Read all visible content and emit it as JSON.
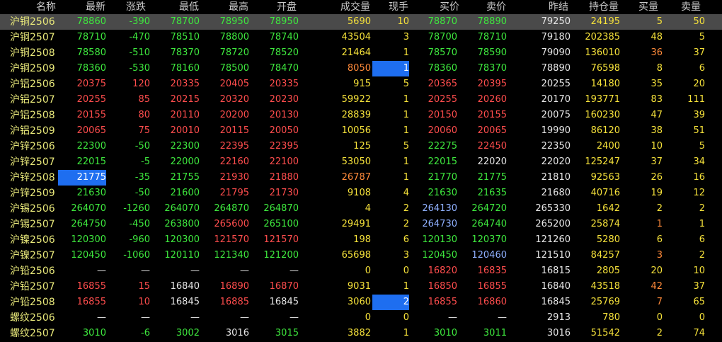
{
  "colors": {
    "up": "#ff4d4d",
    "down": "#3ee83e",
    "flat": "#e6e6e6",
    "yellow": "#f5e13a",
    "orange": "#ff8a3a",
    "blue": "#8fb0ff",
    "highlight": "#1e6ef0"
  },
  "headers": {
    "name": "名称",
    "last": "最新",
    "chg": "涨跌",
    "low": "最低",
    "high": "最高",
    "open": "开盘",
    "vol": "成交量",
    "cur": "现手",
    "bid": "买价",
    "ask": "卖价",
    "pre": "昨结",
    "oi": "持仓量",
    "bq": "买量",
    "aq": "卖量"
  },
  "rows": [
    {
      "name": "沪铜2506",
      "last": "78860",
      "chg": "-390",
      "low": "78700",
      "high": "78950",
      "open": "78950",
      "vol": "5690",
      "cur": "10",
      "bid": "78870",
      "ask": "78890",
      "pre": "79250",
      "oi": "24195",
      "bq": "5",
      "aq": "50"
    },
    {
      "name": "沪铜2507",
      "last": "78710",
      "chg": "-470",
      "low": "78510",
      "high": "78800",
      "open": "78740",
      "vol": "43504",
      "cur": "3",
      "bid": "78700",
      "ask": "78710",
      "pre": "79180",
      "oi": "202385",
      "bq": "48",
      "aq": "5"
    },
    {
      "name": "沪铜2508",
      "last": "78580",
      "chg": "-510",
      "low": "78370",
      "high": "78720",
      "open": "78520",
      "vol": "21464",
      "cur": "1",
      "bid": "78570",
      "ask": "78590",
      "pre": "79090",
      "oi": "136010",
      "bq": "36",
      "aq": "37"
    },
    {
      "name": "沪铜2509",
      "last": "78360",
      "chg": "-530",
      "low": "78160",
      "high": "78500",
      "open": "78470",
      "vol": "8050",
      "cur": "1",
      "bid": "78360",
      "ask": "78370",
      "pre": "78890",
      "oi": "76598",
      "bq": "8",
      "aq": "6"
    },
    {
      "name": "沪铝2506",
      "last": "20375",
      "chg": "120",
      "low": "20335",
      "high": "20405",
      "open": "20335",
      "vol": "915",
      "cur": "5",
      "bid": "20365",
      "ask": "20395",
      "pre": "20255",
      "oi": "14180",
      "bq": "35",
      "aq": "20"
    },
    {
      "name": "沪铝2507",
      "last": "20255",
      "chg": "85",
      "low": "20215",
      "high": "20320",
      "open": "20230",
      "vol": "59922",
      "cur": "1",
      "bid": "20255",
      "ask": "20260",
      "pre": "20170",
      "oi": "193771",
      "bq": "83",
      "aq": "111"
    },
    {
      "name": "沪铝2508",
      "last": "20155",
      "chg": "80",
      "low": "20110",
      "high": "20200",
      "open": "20130",
      "vol": "28839",
      "cur": "1",
      "bid": "20150",
      "ask": "20155",
      "pre": "20075",
      "oi": "160230",
      "bq": "47",
      "aq": "39"
    },
    {
      "name": "沪铝2509",
      "last": "20065",
      "chg": "75",
      "low": "20010",
      "high": "20115",
      "open": "20050",
      "vol": "10056",
      "cur": "1",
      "bid": "20060",
      "ask": "20065",
      "pre": "19990",
      "oi": "86120",
      "bq": "38",
      "aq": "51"
    },
    {
      "name": "沪锌2506",
      "last": "22300",
      "chg": "-50",
      "low": "22300",
      "high": "22395",
      "open": "22395",
      "vol": "125",
      "cur": "5",
      "bid": "22275",
      "ask": "22450",
      "pre": "22350",
      "oi": "2400",
      "bq": "10",
      "aq": "5"
    },
    {
      "name": "沪锌2507",
      "last": "22015",
      "chg": "-5",
      "low": "22000",
      "high": "22160",
      "open": "22100",
      "vol": "53050",
      "cur": "1",
      "bid": "22015",
      "ask": "22020",
      "pre": "22020",
      "oi": "125247",
      "bq": "37",
      "aq": "34"
    },
    {
      "name": "沪锌2508",
      "last": "21775",
      "chg": "-35",
      "low": "21755",
      "high": "21930",
      "open": "21880",
      "vol": "26787",
      "cur": "1",
      "bid": "21770",
      "ask": "21775",
      "pre": "21810",
      "oi": "92563",
      "bq": "26",
      "aq": "16"
    },
    {
      "name": "沪锌2509",
      "last": "21630",
      "chg": "-50",
      "low": "21600",
      "high": "21795",
      "open": "21730",
      "vol": "9108",
      "cur": "4",
      "bid": "21630",
      "ask": "21635",
      "pre": "21680",
      "oi": "40716",
      "bq": "19",
      "aq": "12"
    },
    {
      "name": "沪锡2506",
      "last": "264070",
      "chg": "-1260",
      "low": "264070",
      "high": "264870",
      "open": "264870",
      "vol": "4",
      "cur": "2",
      "bid": "264130",
      "ask": "264720",
      "pre": "265330",
      "oi": "1642",
      "bq": "2",
      "aq": "2"
    },
    {
      "name": "沪锡2507",
      "last": "264750",
      "chg": "-450",
      "low": "263800",
      "high": "265600",
      "open": "265100",
      "vol": "29491",
      "cur": "2",
      "bid": "264730",
      "ask": "264740",
      "pre": "265200",
      "oi": "25874",
      "bq": "1",
      "aq": "1"
    },
    {
      "name": "沪镍2506",
      "last": "120300",
      "chg": "-960",
      "low": "120300",
      "high": "121570",
      "open": "121570",
      "vol": "198",
      "cur": "6",
      "bid": "120130",
      "ask": "120370",
      "pre": "121260",
      "oi": "5280",
      "bq": "6",
      "aq": "6"
    },
    {
      "name": "沪镍2507",
      "last": "120450",
      "chg": "-1060",
      "low": "120110",
      "high": "121340",
      "open": "121200",
      "vol": "65698",
      "cur": "3",
      "bid": "120450",
      "ask": "120460",
      "pre": "121510",
      "oi": "84257",
      "bq": "3",
      "aq": "2"
    },
    {
      "name": "沪铅2506",
      "last": "—",
      "chg": "—",
      "low": "—",
      "high": "—",
      "open": "—",
      "vol": "0",
      "cur": "0",
      "bid": "16820",
      "ask": "16835",
      "pre": "16815",
      "oi": "2805",
      "bq": "20",
      "aq": "10"
    },
    {
      "name": "沪铅2507",
      "last": "16855",
      "chg": "15",
      "low": "16840",
      "high": "16890",
      "open": "16870",
      "vol": "9031",
      "cur": "1",
      "bid": "16850",
      "ask": "16855",
      "pre": "16840",
      "oi": "43518",
      "bq": "42",
      "aq": "37"
    },
    {
      "name": "沪铅2508",
      "last": "16855",
      "chg": "10",
      "low": "16845",
      "high": "16885",
      "open": "16845",
      "vol": "3060",
      "cur": "2",
      "bid": "16855",
      "ask": "16860",
      "pre": "16845",
      "oi": "25769",
      "bq": "7",
      "aq": "65"
    },
    {
      "name": "螺纹2506",
      "last": "—",
      "chg": "—",
      "low": "—",
      "high": "—",
      "open": "—",
      "vol": "0",
      "cur": "0",
      "bid": "—",
      "ask": "—",
      "pre": "2913",
      "oi": "780",
      "bq": "0",
      "aq": "0"
    },
    {
      "name": "螺纹2507",
      "last": "3010",
      "chg": "-6",
      "low": "3002",
      "high": "3016",
      "open": "3015",
      "vol": "3882",
      "cur": "1",
      "bid": "3010",
      "ask": "3011",
      "pre": "3016",
      "oi": "51542",
      "bq": "2",
      "aq": "74"
    }
  ]
}
